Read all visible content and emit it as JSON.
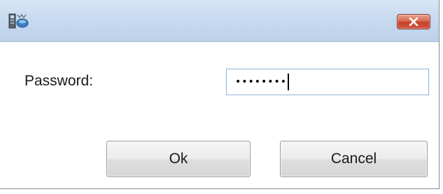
{
  "window": {
    "title": "",
    "icon": "app-keyring-icon",
    "close_icon": "close-icon"
  },
  "form": {
    "password_label": "Password:",
    "password_masked": "••••••••"
  },
  "buttons": {
    "ok_label": "Ok",
    "cancel_label": "Cancel"
  },
  "colors": {
    "titlebar": "#c5d8ef",
    "close_button": "#d9674f",
    "field_border": "#8fb3d6"
  }
}
